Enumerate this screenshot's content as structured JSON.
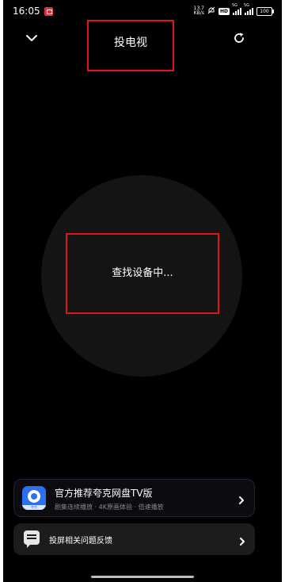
{
  "status_bar": {
    "time": "16:05",
    "net_speed": "13.7",
    "net_unit": "KB/s",
    "hd_label": "HD",
    "sim1_label": "5G",
    "sim2_label": "5G",
    "battery": "100"
  },
  "header": {
    "title": "投电视",
    "back_icon": "chevron-down-icon",
    "refresh_icon": "refresh-icon"
  },
  "main": {
    "status_text": "查找设备中..."
  },
  "promo": {
    "title": "官方推荐夸克网盘TV版",
    "subtitle": "剧集连续播放 · 4K原画体验 · 倍速播放",
    "logo_strip_text": "夸克"
  },
  "feedback": {
    "label": "投屏相关问题反馈"
  },
  "colors": {
    "background": "#000000",
    "highlight_border": "#e0151b",
    "accent_blue": "#2c6ff0"
  }
}
